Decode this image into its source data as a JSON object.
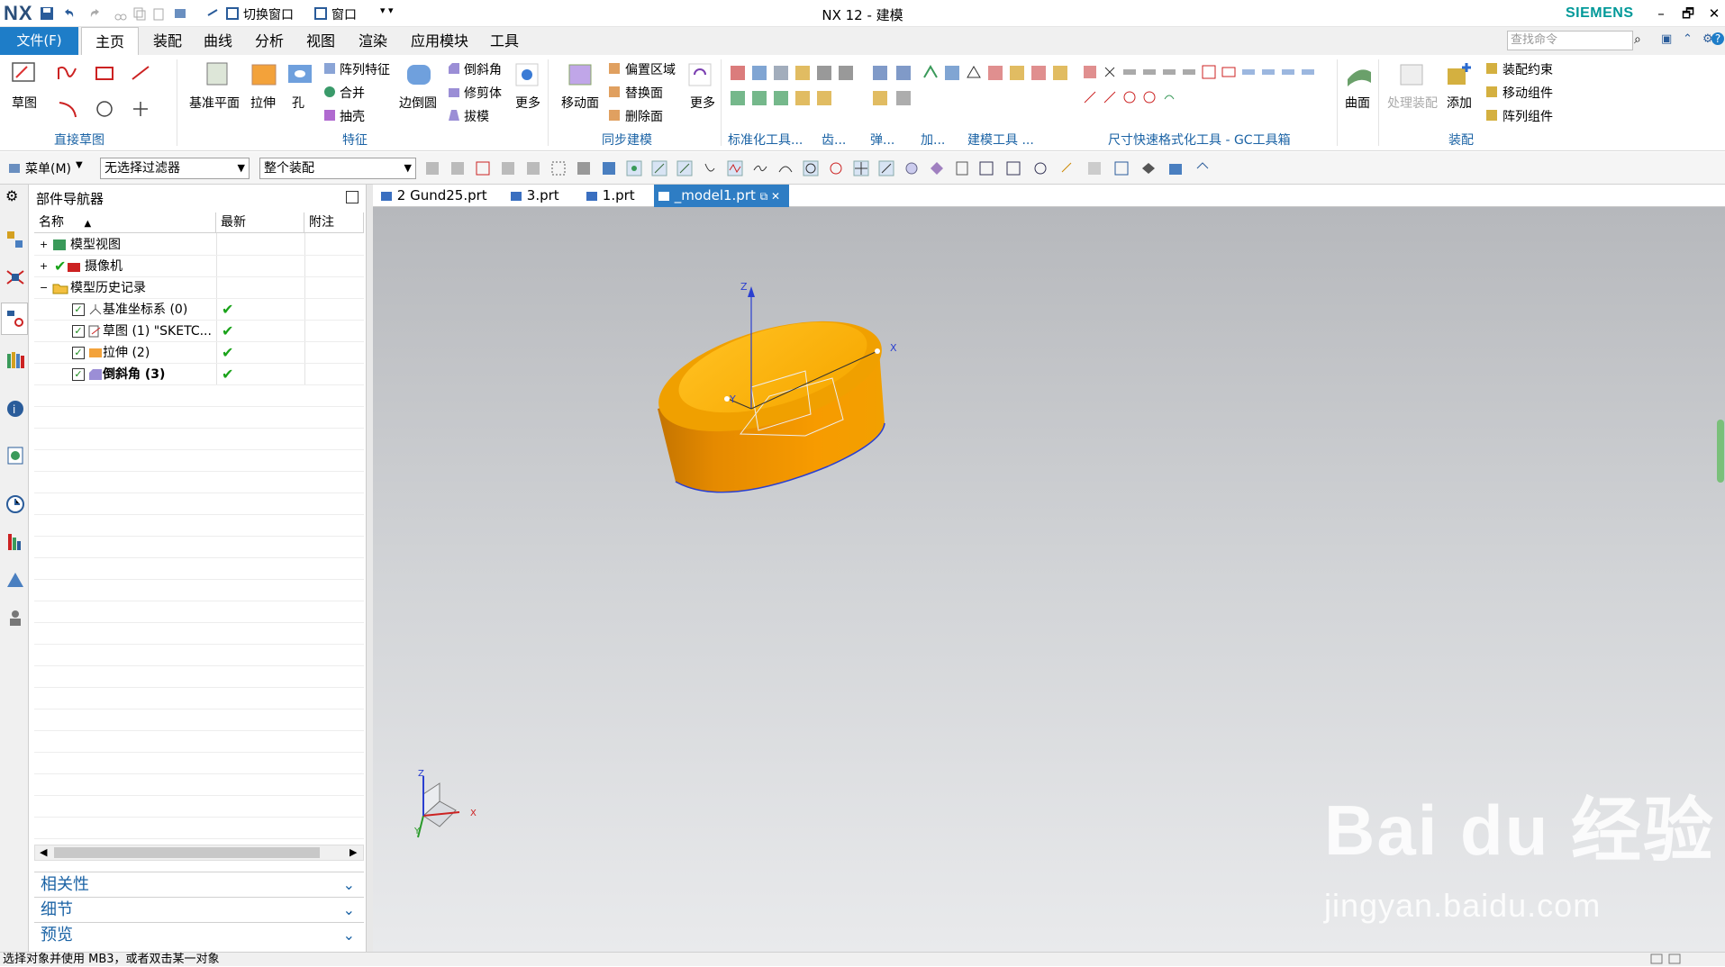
{
  "titlebar": {
    "logo": "NX",
    "switch_window": "切换窗口",
    "window_menu": "窗口",
    "title": "NX 12 - 建模",
    "brand": "SIEMENS",
    "minimize": "–",
    "restore": "🗗",
    "close": "✕"
  },
  "ribbon_tabs": {
    "file": "文件(F)",
    "items": [
      "主页",
      "装配",
      "曲线",
      "分析",
      "视图",
      "渲染",
      "应用模块",
      "工具"
    ]
  },
  "search": {
    "placeholder": "查找命令"
  },
  "ribbon": {
    "sketch": "草图",
    "datum_plane": "基准平面",
    "extrude": "拉伸",
    "hole": "孔",
    "pattern_feature": "阵列特征",
    "unite": "合并",
    "shell": "抽壳",
    "edge_blend": "边倒圆",
    "chamfer": "倒斜角",
    "trim_body": "修剪体",
    "draft": "拔模",
    "more1": "更多",
    "move_face": "移动面",
    "offset_region": "偏置区域",
    "replace_face": "替换面",
    "delete_face": "删除面",
    "more2": "更多",
    "surface": "曲面",
    "process_assembly": "处理装配",
    "add": "添加",
    "assembly_constraints": "装配约束",
    "move_component": "移动组件",
    "pattern_component": "阵列组件",
    "groups": {
      "direct_sketch": "直接草图",
      "feature": "特征",
      "sync_modeling": "同步建模",
      "std_tools": "标准化工具...",
      "gear": "齿...",
      "spring": "弹...",
      "machining": "加...",
      "modeling_tools": "建模工具 ...",
      "dim": "尺寸快速格式化工具 - GC工具箱",
      "assembly": "装配"
    }
  },
  "toolbar2": {
    "menu": "菜单(M)",
    "filter": "无选择过滤器",
    "scope": "整个装配"
  },
  "navigator": {
    "title": "部件导航器",
    "columns": [
      "名称",
      "最新",
      "附注"
    ],
    "rows": [
      {
        "label": "模型视图",
        "latest": ""
      },
      {
        "label": "摄像机",
        "latest": ""
      },
      {
        "label": "模型历史记录",
        "latest": ""
      },
      {
        "label": "基准坐标系 (0)",
        "latest": "✔"
      },
      {
        "label": "草图 (1) \"SKETC...",
        "latest": "✔"
      },
      {
        "label": "拉伸 (2)",
        "latest": "✔"
      },
      {
        "label": "倒斜角 (3)",
        "latest": "✔"
      }
    ],
    "panels": [
      "相关性",
      "细节",
      "预览"
    ]
  },
  "doc_tabs": [
    "2 Gund25.prt",
    "3.prt",
    "1.prt",
    "_model1.prt"
  ],
  "viewport": {
    "axis_x": "X",
    "axis_y": "Y",
    "axis_z": "Z",
    "watermark": "Bai du 经验",
    "watermark_url": "jingyan.baidu.com"
  },
  "status": {
    "text": "选择对象并使用 MB3，或者双击某一对象"
  },
  "colors": {
    "accent": "#1e7dc8",
    "part": "#f5a000",
    "check": "#1aa31a"
  }
}
